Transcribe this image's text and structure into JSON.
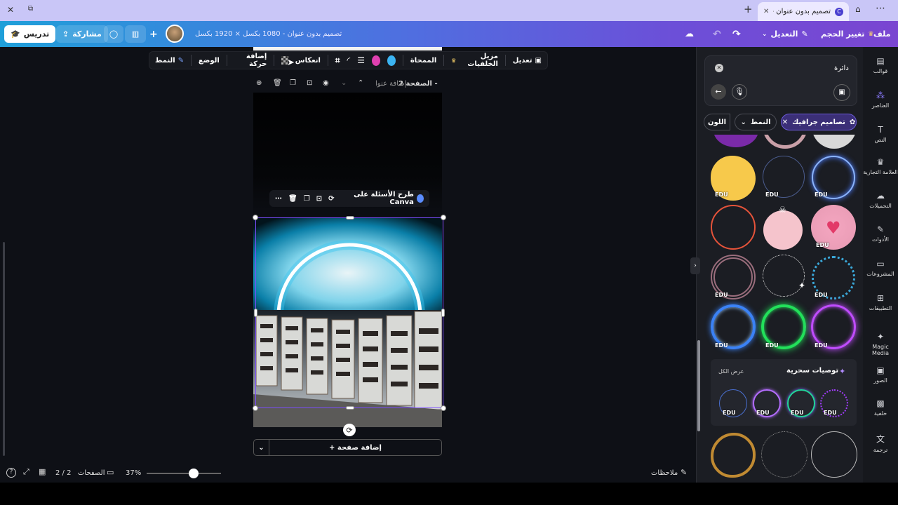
{
  "window": {
    "tab_title": "تصميم بدون عنوان - 0...",
    "close_label": "✕",
    "new_tab_label": "+",
    "menu_label": "⋯"
  },
  "header": {
    "file_label": "ملف",
    "resize_label": "تغيير الحجم",
    "edit_label": "التعديل",
    "doc_title": "تصميم بدون عنوان - 1080 بكسل × 1920 بكسل",
    "share_label": "مشاركة",
    "teach_label": "تدريس",
    "plus_label": "+"
  },
  "toolbar": {
    "edit_label": "تعديل",
    "bg_remover_label": "مزيل الخلفيات",
    "eraser_label": "الممحاة",
    "flip_label": "انعكاس",
    "animate_label": "إضافة حركة",
    "position_label": "الوضع",
    "style_label": "النمط"
  },
  "pagebar": {
    "page_label": "الصفحة 2 -",
    "page_title_placeholder": "إضافة عنوا..."
  },
  "context_menu": {
    "ask_label": "طرح الأسئلة على Canva",
    "more_label": "⋯"
  },
  "canvas": {
    "add_page_label": "+ إضافة صفحة"
  },
  "bottom": {
    "notes_label": "ملاحظات",
    "zoom_label": "37%",
    "zoom_fraction": 0.63,
    "pages_label": "الصفحات",
    "page_count": "2 / 2"
  },
  "panel": {
    "search_value": "دائرة",
    "filters": {
      "graphics_label": "تصاميم جرافيك",
      "style_label": "النمط",
      "color_label": "اللون"
    },
    "badge_label": "EDU",
    "magic": {
      "title": "توصيات سحرية",
      "see_all": "عرض الكل"
    }
  },
  "rail": {
    "items": [
      "قوالب",
      "العناصر",
      "النص",
      "العلامة التجارية",
      "التحميلات",
      "الأدوات",
      "المشروعات",
      "التطبيقات",
      "Magic Media",
      "الصور",
      "خلفية",
      "ترجمة"
    ]
  },
  "colors": {
    "accent": "#7c4dff",
    "swatch_pink": "#e040b0",
    "swatch_blue": "#3bb4f2"
  }
}
